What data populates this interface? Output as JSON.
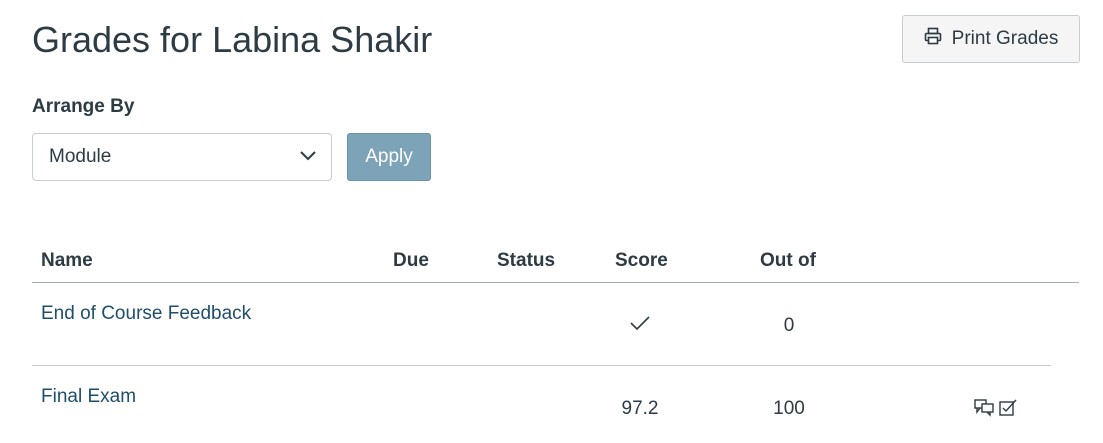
{
  "page": {
    "title": "Grades for Labina Shakir"
  },
  "toolbar": {
    "print_label": "Print Grades"
  },
  "arrange": {
    "label": "Arrange By",
    "selected": "Module",
    "apply_label": "Apply"
  },
  "table": {
    "headers": {
      "name": "Name",
      "due": "Due",
      "status": "Status",
      "score": "Score",
      "out_of": "Out of"
    },
    "rows": [
      {
        "name": "End of Course Feedback",
        "due": "",
        "status": "",
        "score": "",
        "score_icon": "check-icon",
        "out_of": "0"
      },
      {
        "name": "Final Exam",
        "due": "",
        "status": "",
        "score": "97.2",
        "out_of": "100",
        "icons": [
          "comments-icon",
          "rubric-icon"
        ]
      }
    ]
  }
}
